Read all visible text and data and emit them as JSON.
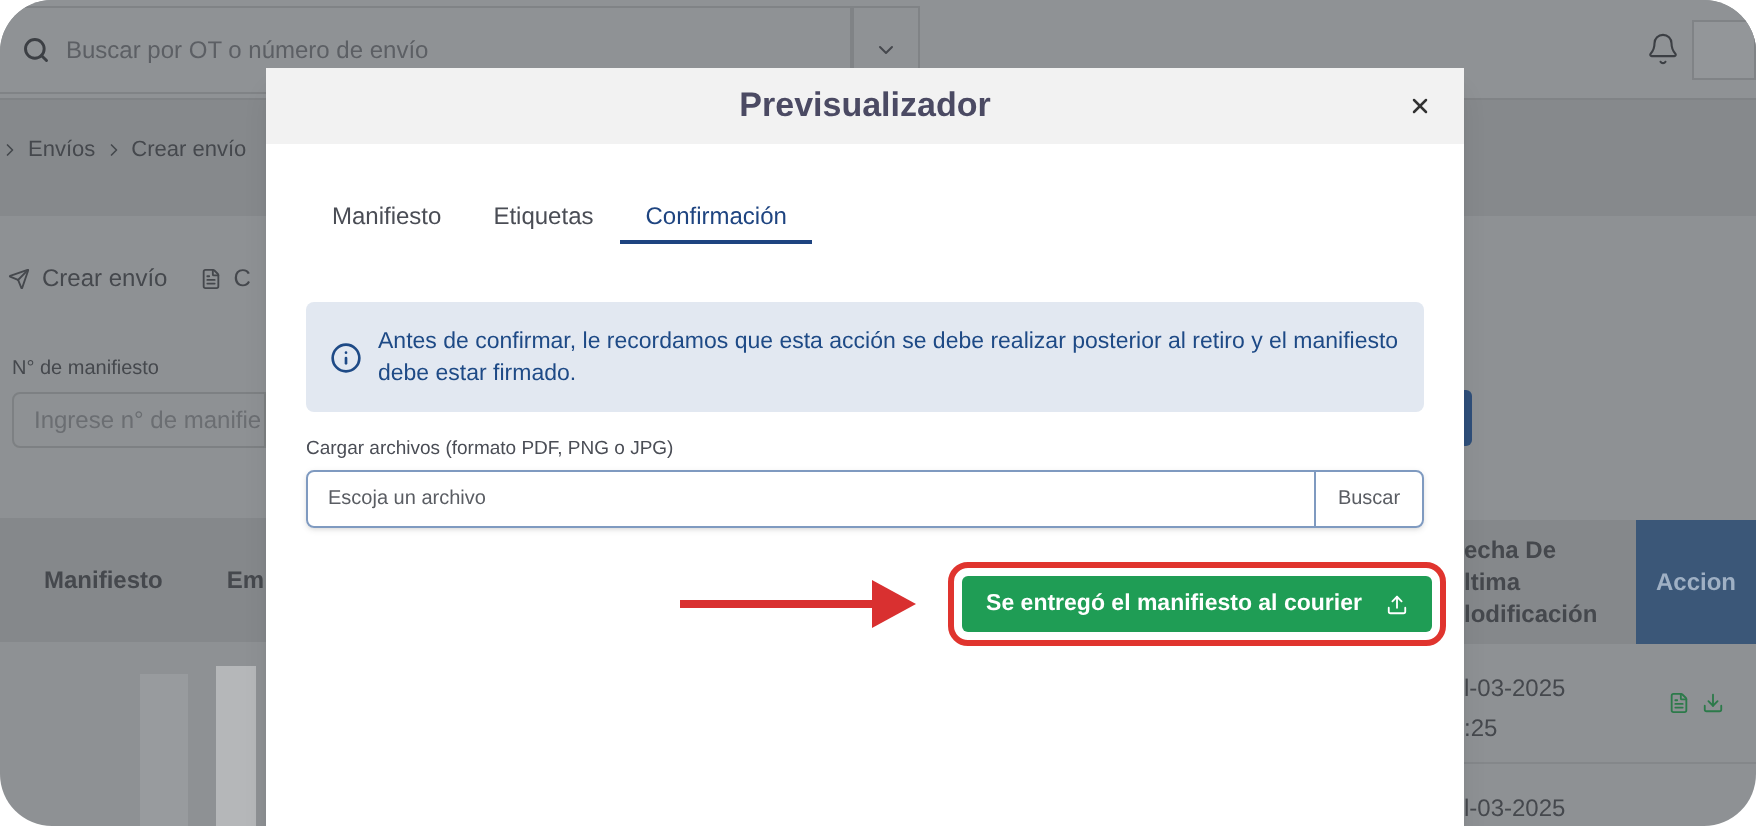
{
  "topbar": {
    "search_placeholder": "Buscar por OT o número de envío"
  },
  "breadcrumb": [
    "Envíos",
    "Crear envío"
  ],
  "actions": [
    {
      "kind": "send",
      "label": "Crear envío"
    },
    {
      "kind": "doc",
      "label": "C"
    }
  ],
  "manifest_filter": {
    "label": "N° de manifiesto",
    "placeholder": "Ingrese n° de manifie"
  },
  "table": {
    "columns_left": [
      "Manifiesto",
      "Em"
    ],
    "columns_right": [
      {
        "kind": "plain",
        "lines": [
          "echa De",
          "ltima",
          "lodificación"
        ]
      },
      {
        "kind": "accent",
        "lines": [
          "Accion"
        ]
      }
    ],
    "rows": [
      {
        "date": "l-03-2025",
        "time": ":25",
        "actions": [
          {
            "kind": "file"
          },
          {
            "kind": "download"
          }
        ]
      },
      {
        "date": "l-03-2025"
      }
    ]
  },
  "modal": {
    "title": "Previsualizador",
    "tabs": [
      {
        "label": "Manifiesto",
        "selected": false
      },
      {
        "label": "Etiquetas",
        "selected": false
      },
      {
        "label": "Confirmación",
        "selected": true
      }
    ],
    "notice": "Antes de confirmar, le recordamos que esta acción se debe realizar posterior al retiro y el manifiesto debe estar firmado.",
    "upload": {
      "label": "Cargar archivos (formato PDF, PNG o JPG)",
      "placeholder": "Escoja un archivo",
      "browse": "Buscar"
    },
    "confirm_button": {
      "label": "Se entregó el manifiesto al courier",
      "highlighted": true
    }
  }
}
